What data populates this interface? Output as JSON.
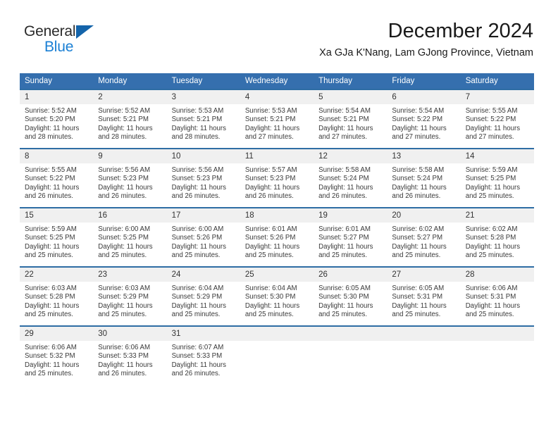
{
  "brand": {
    "name_top": "General",
    "name_bottom": "Blue",
    "triangle_color": "#1464aa",
    "blue_color": "#1a7fd4"
  },
  "header": {
    "title": "December 2024",
    "subtitle": "Xa GJa K'Nang, Lam GJong Province, Vietnam"
  },
  "theme": {
    "header_row_bg": "#356fae",
    "cell_border_top": "#2e6da4",
    "daynum_bg": "#f0f0f0",
    "text": "#3a3a3a"
  },
  "weekdays": [
    "Sunday",
    "Monday",
    "Tuesday",
    "Wednesday",
    "Thursday",
    "Friday",
    "Saturday"
  ],
  "weeks": [
    [
      {
        "day": "1",
        "sunrise": "Sunrise: 5:52 AM",
        "sunset": "Sunset: 5:20 PM",
        "daylight1": "Daylight: 11 hours",
        "daylight2": "and 28 minutes."
      },
      {
        "day": "2",
        "sunrise": "Sunrise: 5:52 AM",
        "sunset": "Sunset: 5:21 PM",
        "daylight1": "Daylight: 11 hours",
        "daylight2": "and 28 minutes."
      },
      {
        "day": "3",
        "sunrise": "Sunrise: 5:53 AM",
        "sunset": "Sunset: 5:21 PM",
        "daylight1": "Daylight: 11 hours",
        "daylight2": "and 28 minutes."
      },
      {
        "day": "4",
        "sunrise": "Sunrise: 5:53 AM",
        "sunset": "Sunset: 5:21 PM",
        "daylight1": "Daylight: 11 hours",
        "daylight2": "and 27 minutes."
      },
      {
        "day": "5",
        "sunrise": "Sunrise: 5:54 AM",
        "sunset": "Sunset: 5:21 PM",
        "daylight1": "Daylight: 11 hours",
        "daylight2": "and 27 minutes."
      },
      {
        "day": "6",
        "sunrise": "Sunrise: 5:54 AM",
        "sunset": "Sunset: 5:22 PM",
        "daylight1": "Daylight: 11 hours",
        "daylight2": "and 27 minutes."
      },
      {
        "day": "7",
        "sunrise": "Sunrise: 5:55 AM",
        "sunset": "Sunset: 5:22 PM",
        "daylight1": "Daylight: 11 hours",
        "daylight2": "and 27 minutes."
      }
    ],
    [
      {
        "day": "8",
        "sunrise": "Sunrise: 5:55 AM",
        "sunset": "Sunset: 5:22 PM",
        "daylight1": "Daylight: 11 hours",
        "daylight2": "and 26 minutes."
      },
      {
        "day": "9",
        "sunrise": "Sunrise: 5:56 AM",
        "sunset": "Sunset: 5:23 PM",
        "daylight1": "Daylight: 11 hours",
        "daylight2": "and 26 minutes."
      },
      {
        "day": "10",
        "sunrise": "Sunrise: 5:56 AM",
        "sunset": "Sunset: 5:23 PM",
        "daylight1": "Daylight: 11 hours",
        "daylight2": "and 26 minutes."
      },
      {
        "day": "11",
        "sunrise": "Sunrise: 5:57 AM",
        "sunset": "Sunset: 5:23 PM",
        "daylight1": "Daylight: 11 hours",
        "daylight2": "and 26 minutes."
      },
      {
        "day": "12",
        "sunrise": "Sunrise: 5:58 AM",
        "sunset": "Sunset: 5:24 PM",
        "daylight1": "Daylight: 11 hours",
        "daylight2": "and 26 minutes."
      },
      {
        "day": "13",
        "sunrise": "Sunrise: 5:58 AM",
        "sunset": "Sunset: 5:24 PM",
        "daylight1": "Daylight: 11 hours",
        "daylight2": "and 26 minutes."
      },
      {
        "day": "14",
        "sunrise": "Sunrise: 5:59 AM",
        "sunset": "Sunset: 5:25 PM",
        "daylight1": "Daylight: 11 hours",
        "daylight2": "and 25 minutes."
      }
    ],
    [
      {
        "day": "15",
        "sunrise": "Sunrise: 5:59 AM",
        "sunset": "Sunset: 5:25 PM",
        "daylight1": "Daylight: 11 hours",
        "daylight2": "and 25 minutes."
      },
      {
        "day": "16",
        "sunrise": "Sunrise: 6:00 AM",
        "sunset": "Sunset: 5:25 PM",
        "daylight1": "Daylight: 11 hours",
        "daylight2": "and 25 minutes."
      },
      {
        "day": "17",
        "sunrise": "Sunrise: 6:00 AM",
        "sunset": "Sunset: 5:26 PM",
        "daylight1": "Daylight: 11 hours",
        "daylight2": "and 25 minutes."
      },
      {
        "day": "18",
        "sunrise": "Sunrise: 6:01 AM",
        "sunset": "Sunset: 5:26 PM",
        "daylight1": "Daylight: 11 hours",
        "daylight2": "and 25 minutes."
      },
      {
        "day": "19",
        "sunrise": "Sunrise: 6:01 AM",
        "sunset": "Sunset: 5:27 PM",
        "daylight1": "Daylight: 11 hours",
        "daylight2": "and 25 minutes."
      },
      {
        "day": "20",
        "sunrise": "Sunrise: 6:02 AM",
        "sunset": "Sunset: 5:27 PM",
        "daylight1": "Daylight: 11 hours",
        "daylight2": "and 25 minutes."
      },
      {
        "day": "21",
        "sunrise": "Sunrise: 6:02 AM",
        "sunset": "Sunset: 5:28 PM",
        "daylight1": "Daylight: 11 hours",
        "daylight2": "and 25 minutes."
      }
    ],
    [
      {
        "day": "22",
        "sunrise": "Sunrise: 6:03 AM",
        "sunset": "Sunset: 5:28 PM",
        "daylight1": "Daylight: 11 hours",
        "daylight2": "and 25 minutes."
      },
      {
        "day": "23",
        "sunrise": "Sunrise: 6:03 AM",
        "sunset": "Sunset: 5:29 PM",
        "daylight1": "Daylight: 11 hours",
        "daylight2": "and 25 minutes."
      },
      {
        "day": "24",
        "sunrise": "Sunrise: 6:04 AM",
        "sunset": "Sunset: 5:29 PM",
        "daylight1": "Daylight: 11 hours",
        "daylight2": "and 25 minutes."
      },
      {
        "day": "25",
        "sunrise": "Sunrise: 6:04 AM",
        "sunset": "Sunset: 5:30 PM",
        "daylight1": "Daylight: 11 hours",
        "daylight2": "and 25 minutes."
      },
      {
        "day": "26",
        "sunrise": "Sunrise: 6:05 AM",
        "sunset": "Sunset: 5:30 PM",
        "daylight1": "Daylight: 11 hours",
        "daylight2": "and 25 minutes."
      },
      {
        "day": "27",
        "sunrise": "Sunrise: 6:05 AM",
        "sunset": "Sunset: 5:31 PM",
        "daylight1": "Daylight: 11 hours",
        "daylight2": "and 25 minutes."
      },
      {
        "day": "28",
        "sunrise": "Sunrise: 6:06 AM",
        "sunset": "Sunset: 5:31 PM",
        "daylight1": "Daylight: 11 hours",
        "daylight2": "and 25 minutes."
      }
    ],
    [
      {
        "day": "29",
        "sunrise": "Sunrise: 6:06 AM",
        "sunset": "Sunset: 5:32 PM",
        "daylight1": "Daylight: 11 hours",
        "daylight2": "and 25 minutes."
      },
      {
        "day": "30",
        "sunrise": "Sunrise: 6:06 AM",
        "sunset": "Sunset: 5:33 PM",
        "daylight1": "Daylight: 11 hours",
        "daylight2": "and 26 minutes."
      },
      {
        "day": "31",
        "sunrise": "Sunrise: 6:07 AM",
        "sunset": "Sunset: 5:33 PM",
        "daylight1": "Daylight: 11 hours",
        "daylight2": "and 26 minutes."
      },
      {
        "day": "",
        "sunrise": "",
        "sunset": "",
        "daylight1": "",
        "daylight2": ""
      },
      {
        "day": "",
        "sunrise": "",
        "sunset": "",
        "daylight1": "",
        "daylight2": ""
      },
      {
        "day": "",
        "sunrise": "",
        "sunset": "",
        "daylight1": "",
        "daylight2": ""
      },
      {
        "day": "",
        "sunrise": "",
        "sunset": "",
        "daylight1": "",
        "daylight2": ""
      }
    ]
  ]
}
